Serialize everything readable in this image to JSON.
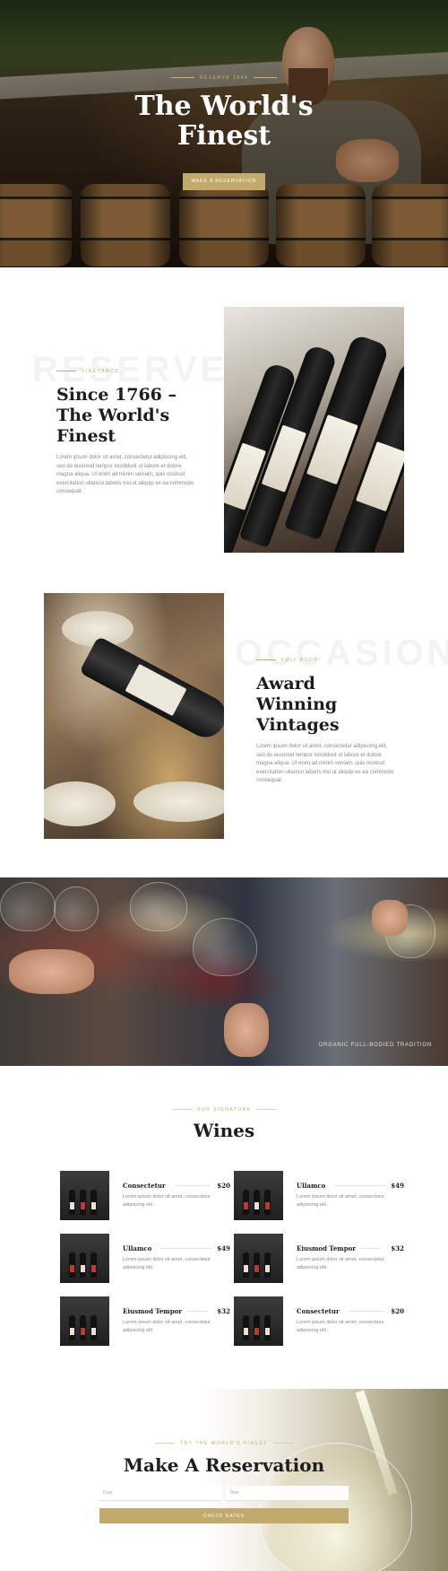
{
  "hero": {
    "eyebrow": "Reserve 1846",
    "title_line1": "The World's",
    "title_line2": "Finest",
    "button_label": "Make a Reservation"
  },
  "about": {
    "ghost_word": "RESERVE",
    "eyebrow": "Vineyards",
    "title_line1": "Since 1766 –",
    "title_line2": "The World's",
    "title_line3": "Finest",
    "body": "Lorem ipsum dolor sit amet, consectetur adipiscing elit, sed do eiusmod tempor incididunt ut labore et dolore magna aliqua. Ut enim ad minim veniam, quis nostrud exercitation ullamco laboris nisi ut aliquip ex ea commodo consequat."
  },
  "awards": {
    "ghost_word": "OCCASION",
    "eyebrow": "Full Body",
    "title_line1": "Award",
    "title_line2": "Winning",
    "title_line3": "Vintages",
    "body": "Lorem ipsum dolor sit amet, consectetur adipiscing elit, sed do eiusmod tempor incididunt ut labore et dolore magna aliqua. Ut enim ad minim veniam, quis nostrud exercitation ullamco laboris nisi ut aliquip ex ea commodo consequat."
  },
  "banner": {
    "caption": "Organic Full-Bodied Tradition"
  },
  "menu": {
    "eyebrow": "Our Signature",
    "title": "Wines",
    "items": [
      {
        "name": "Consectetur",
        "price": "$20",
        "desc": "Lorem ipsum dolor sit amet, consectetur adipiscing elit."
      },
      {
        "name": "Ullamco",
        "price": "$49",
        "desc": "Lorem ipsum dolor sit amet, consectetur adipiscing elit."
      },
      {
        "name": "Ullamco",
        "price": "$49",
        "desc": "Lorem ipsum dolor sit amet, consectetur adipiscing elit."
      },
      {
        "name": "Eiusmod Tempor",
        "price": "$32",
        "desc": "Lorem ipsum dolor sit amet, consectetur adipiscing elit."
      },
      {
        "name": "Eiusmod Tempor",
        "price": "$32",
        "desc": "Lorem ipsum dolor sit amet, consectetur adipiscing elit."
      },
      {
        "name": "Consectetur",
        "price": "$20",
        "desc": "Lorem ipsum dolor sit amet, consectetur adipiscing elit."
      }
    ]
  },
  "reservation": {
    "eyebrow": "Try the World's Finest",
    "title": "Make A Reservation",
    "date_placeholder": "Date",
    "time_placeholder": "Time",
    "button_label": "Check Dates"
  },
  "colors": {
    "accent": "#c2aa6e",
    "heading": "#1d1d1d",
    "body_text": "#8a8a8a"
  }
}
